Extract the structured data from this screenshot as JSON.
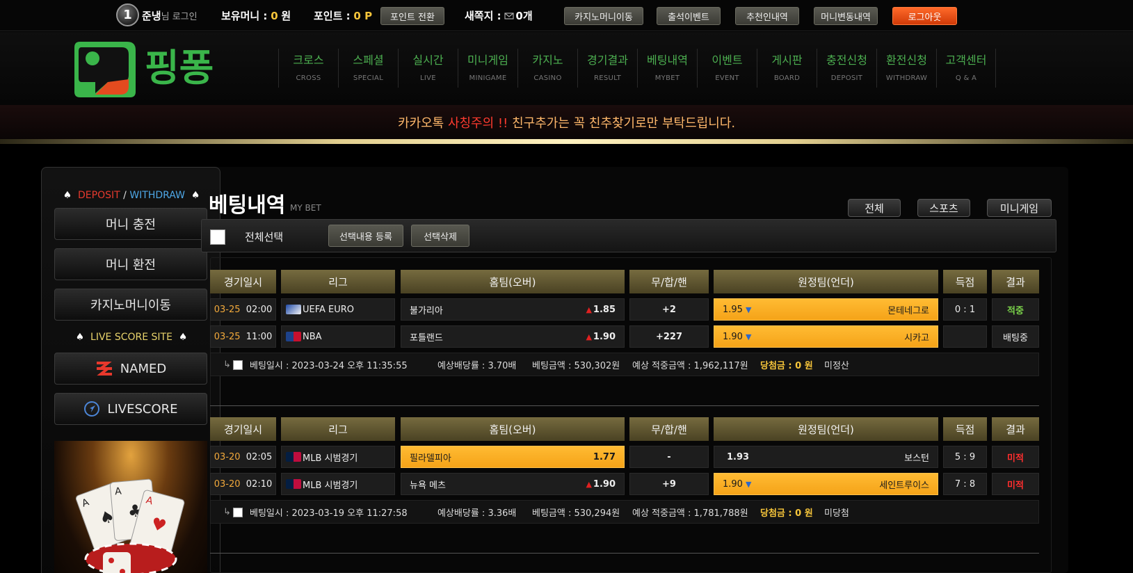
{
  "topbar": {
    "level": "1",
    "username": "준냉",
    "login_suffix": "님 로그인",
    "money_label": "보유머니 :",
    "money_value": "0",
    "money_unit": "원",
    "point_label": "포인트 :",
    "point_value": "0 P",
    "point_btn": "포인트 전환",
    "message_label": "새쪽지 :",
    "message_value": "0개",
    "buttons": [
      "카지노머니이동",
      "출석이벤트",
      "추천인내역",
      "머니변동내역"
    ],
    "logout": "로그아웃"
  },
  "header": {
    "logo_text": "핑퐁",
    "nav": [
      {
        "ko": "크로스",
        "en": "CROSS"
      },
      {
        "ko": "스페셜",
        "en": "SPECIAL"
      },
      {
        "ko": "실시간",
        "en": "LIVE"
      },
      {
        "ko": "미니게임",
        "en": "MINIGAME"
      },
      {
        "ko": "카지노",
        "en": "CASINO"
      },
      {
        "ko": "경기결과",
        "en": "RESULT"
      },
      {
        "ko": "베팅내역",
        "en": "MYBET"
      },
      {
        "ko": "이벤트",
        "en": "EVENT"
      },
      {
        "ko": "게시판",
        "en": "BOARD"
      },
      {
        "ko": "충전신청",
        "en": "DEPOSIT"
      },
      {
        "ko": "환전신청",
        "en": "WITHDRAW"
      },
      {
        "ko": "고객센터",
        "en": "Q & A"
      }
    ]
  },
  "notice": {
    "part1": "카카오톡",
    "part2": "사칭주의 !!",
    "part3": "친구추가는 꼭 친추찾기로만 부탁드립니다."
  },
  "sidebar": {
    "deposit": "DEPOSIT",
    "slash": "/",
    "withdraw": "WITHDRAW",
    "spade": "♠",
    "charge_btn": "머니 충전",
    "exchange_btn": "머니 환전",
    "casino_btn": "카지노머니이동",
    "live_title": "LIVE SCORE SITE",
    "named_btn": "NAMED",
    "livescore_btn": "LIVESCORE"
  },
  "main": {
    "title": "베팅내역",
    "subtitle": "MY BET",
    "filters": [
      "전체",
      "스포츠",
      "미니게임"
    ],
    "select_all": "전체선택",
    "register_btn": "선택내용 등록",
    "delete_btn": "선택삭제",
    "headers": [
      "경기일시",
      "리그",
      "홈팀(오버)",
      "무/합/핸",
      "원정팀(언더)",
      "득점",
      "결과"
    ]
  },
  "bets": [
    {
      "rows": [
        {
          "date": "03-25",
          "time": "02:00",
          "league": "UEFA EURO",
          "home": "불가리아",
          "home_odds": "1.85",
          "home_arrow": "▲",
          "home_selected": false,
          "mid": "+2",
          "away": "몬테네그로",
          "away_odds": "1.95",
          "away_arrow": "▼",
          "away_selected": true,
          "score": "0 : 1",
          "result": "적중",
          "result_color": "#7ad14a"
        },
        {
          "date": "03-25",
          "time": "11:00",
          "league": "NBA",
          "home": "포틀랜드",
          "home_odds": "1.90",
          "home_arrow": "▲",
          "home_selected": false,
          "mid": "+227",
          "away": "시카고",
          "away_odds": "1.90",
          "away_arrow": "▼",
          "away_selected": true,
          "score": "",
          "result": "배팅중",
          "result_color": "#eeeeee"
        }
      ],
      "summary": {
        "bet_time": "베팅일시 : 2023-03-24 오후 11:35:55",
        "odds": "예상배당률 : 3.70배",
        "amount": "베팅금액 : 530,302원",
        "expected": "예상 적중금액 : 1,962,117원",
        "win": "당첨금 : 0 원",
        "status": "미정산"
      }
    },
    {
      "rows": [
        {
          "date": "03-20",
          "time": "02:05",
          "league": "MLB 시범경기",
          "home": "필라델피아",
          "home_odds": "1.77",
          "home_arrow": "",
          "home_selected": true,
          "mid": "-",
          "away": "보스턴",
          "away_odds": "1.93",
          "away_arrow": "",
          "away_selected": false,
          "score": "5 : 9",
          "result": "미적",
          "result_color": "#ff2e2e"
        },
        {
          "date": "03-20",
          "time": "02:10",
          "league": "MLB 시범경기",
          "home": "뉴욕 메츠",
          "home_odds": "1.90",
          "home_arrow": "▲",
          "home_selected": false,
          "mid": "+9",
          "away": "세인트루이스",
          "away_odds": "1.90",
          "away_arrow": "▼",
          "away_selected": true,
          "score": "7 : 8",
          "result": "미적",
          "result_color": "#ff2e2e"
        }
      ],
      "summary": {
        "bet_time": "베팅일시 : 2023-03-19 오후 11:27:58",
        "odds": "예상배당률 : 3.36배",
        "amount": "베팅금액 : 530,294원",
        "expected": "예상 적중금액 : 1,781,788원",
        "win": "당첨금 : 0 원",
        "status": "미당첨"
      }
    }
  ]
}
